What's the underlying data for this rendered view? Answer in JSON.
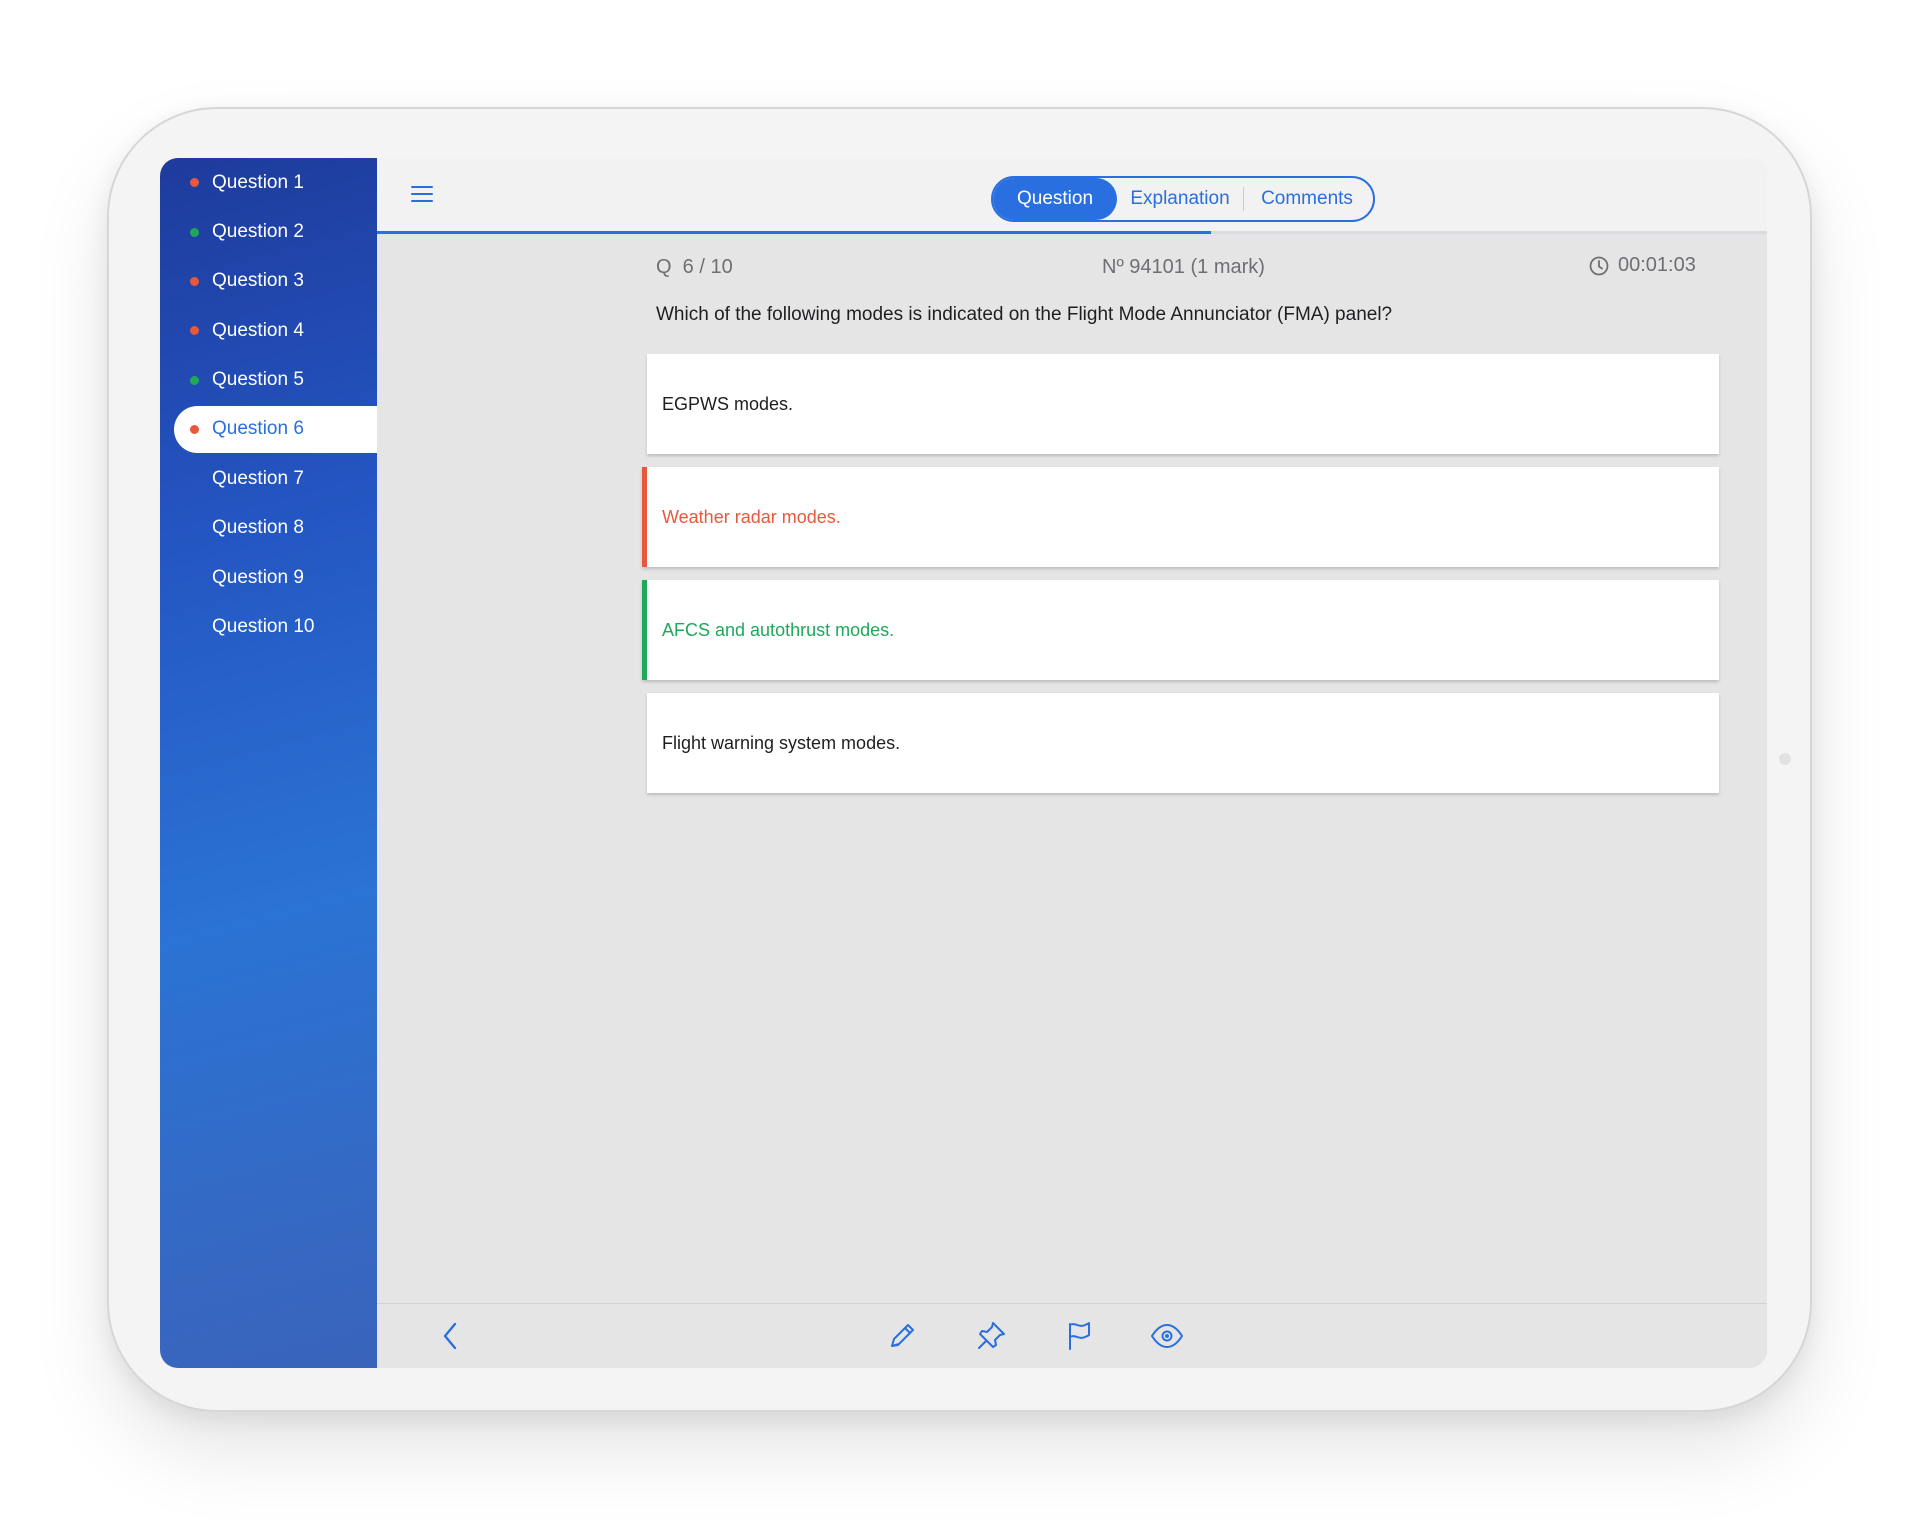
{
  "sidebar": {
    "items": [
      {
        "label": "Question 1",
        "status": "wrong"
      },
      {
        "label": "Question 2",
        "status": "correct"
      },
      {
        "label": "Question 3",
        "status": "wrong"
      },
      {
        "label": "Question 4",
        "status": "wrong"
      },
      {
        "label": "Question 5",
        "status": "correct"
      },
      {
        "label": "Question 6",
        "status": "wrong",
        "active": true
      },
      {
        "label": "Question 7",
        "status": "none"
      },
      {
        "label": "Question 8",
        "status": "none"
      },
      {
        "label": "Question 9",
        "status": "none"
      },
      {
        "label": "Question 10",
        "status": "none"
      }
    ]
  },
  "header": {
    "tabs": [
      {
        "label": "Question",
        "active": true
      },
      {
        "label": "Explanation",
        "active": false
      },
      {
        "label": "Comments",
        "active": false
      }
    ],
    "progress": 0.6
  },
  "question": {
    "counter": "Q  6 / 10",
    "number": "Nº 94101 (1 mark)",
    "timer": "00:01:03",
    "text": "Which of the following modes is indicated on the Flight Mode Annunciator (FMA) panel?",
    "answers": [
      {
        "text": "EGPWS modes.",
        "state": "neutral"
      },
      {
        "text": "Weather radar modes.",
        "state": "wrong"
      },
      {
        "text": "AFCS and autothrust modes.",
        "state": "correct"
      },
      {
        "text": "Flight warning system modes.",
        "state": "neutral"
      }
    ]
  },
  "toolbar": {
    "icons": [
      "chevron-left-icon",
      "pencil-icon",
      "pin-icon",
      "flag-icon",
      "eye-icon"
    ]
  },
  "colors": {
    "accent": "#2a6fe0",
    "wrong": "#e8583c",
    "correct": "#1fa85a"
  }
}
